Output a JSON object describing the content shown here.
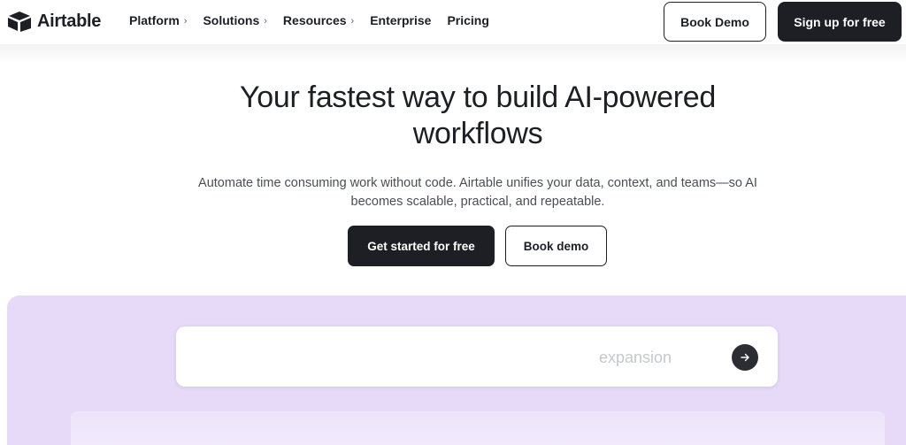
{
  "brand": {
    "name": "Airtable",
    "colors": {
      "dark": "#1d1f25",
      "panel_purple": "#e6daf8",
      "white": "#ffffff"
    }
  },
  "header": {
    "nav": [
      {
        "label": "Platform",
        "has_submenu": true
      },
      {
        "label": "Solutions",
        "has_submenu": true
      },
      {
        "label": "Resources",
        "has_submenu": true
      },
      {
        "label": "Enterprise",
        "has_submenu": false
      },
      {
        "label": "Pricing",
        "has_submenu": false
      }
    ],
    "book_demo_label": "Book Demo",
    "signup_label": "Sign up for free"
  },
  "hero": {
    "title_line1": "Your fastest way to build AI-powered",
    "title_line2": "workflows",
    "subtitle_line1": "Automate time consuming work without code. Airtable unifies your data, context, and teams—so AI",
    "subtitle_line2": "becomes scalable, practical, and repeatable.",
    "primary_cta": "Get started for free",
    "secondary_cta": "Book demo"
  },
  "prompt": {
    "visible_text": "expansion",
    "submit_icon": "arrow-right-icon"
  }
}
